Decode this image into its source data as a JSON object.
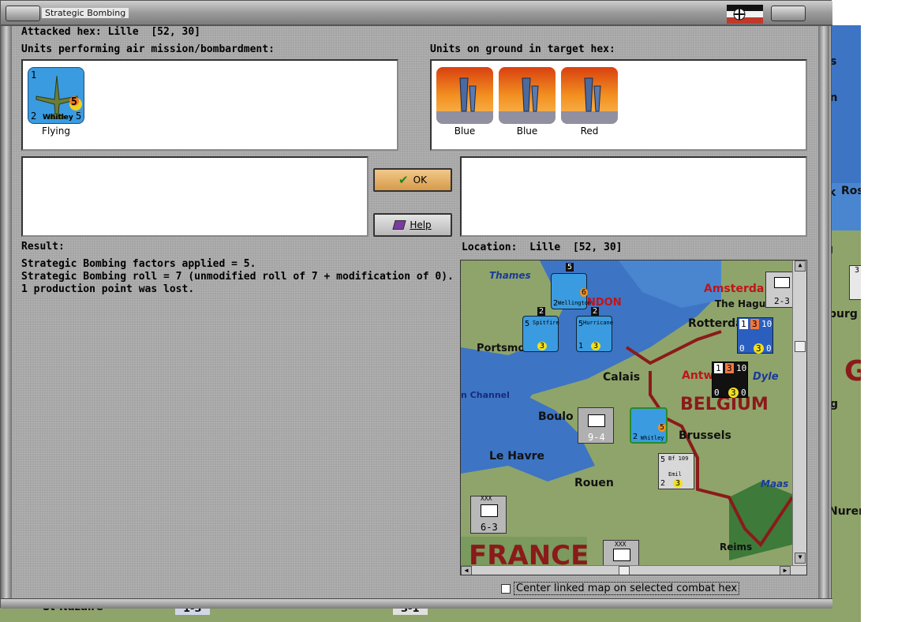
{
  "window": {
    "title": "Strategic Bombing"
  },
  "attacked_hex": "Attacked hex: Lille  [52, 30]",
  "air_units": {
    "heading": "Units performing air mission/bombardment:",
    "items": [
      {
        "name": "Whitley",
        "caption": "Flying",
        "top_left": "1",
        "bottom_left": "2",
        "bottom_right": "5",
        "badge": "5"
      }
    ]
  },
  "ground_units": {
    "heading": "Units on ground in target hex:",
    "items": [
      {
        "caption": "Blue"
      },
      {
        "caption": "Blue"
      },
      {
        "caption": "Red"
      }
    ]
  },
  "buttons": {
    "ok": "OK",
    "help": "Help"
  },
  "result": {
    "heading": "Result:",
    "lines": [
      "Strategic Bombing factors applied = 5.",
      "Strategic Bombing roll = 7 (unmodified roll of 7 + modification of 0).",
      "1 production point was lost."
    ]
  },
  "location": {
    "heading": "Location:  Lille  [52, 30]"
  },
  "minimap": {
    "labels": {
      "thames": "Thames",
      "london": "NDON",
      "amsterdam": "Amsterda",
      "the_hague": "The Hague",
      "rotterdam": "Rotterda",
      "portsmouth": "Portsmo",
      "calais": "Calais",
      "antwerp": "Antw",
      "dyle": "Dyle",
      "channel": "n Channel",
      "boulogne": "Boulo",
      "belgium": "BELGIUM",
      "brussels": "Brussels",
      "le_havre": "Le Havre",
      "rouen": "Rouen",
      "maas": "Maas",
      "reims": "Reims",
      "france": "FRANCE"
    },
    "counters": {
      "wellington": {
        "name": "Wellington",
        "top": "5",
        "a": "2",
        "b": "3",
        "badge": "6"
      },
      "spitfire": {
        "name": "Spitfire",
        "top": "2",
        "a": "5",
        "badge": "3"
      },
      "hurricane": {
        "name": "Hurricane",
        "top": "2",
        "a": "5",
        "b": "1",
        "badge": "3"
      },
      "inf_right": {
        "value": "2-3"
      },
      "dutch_1": {
        "a": "1",
        "b": "3",
        "c": "10",
        "d": "0",
        "e": "0",
        "badge": "3"
      },
      "dutch_2": {
        "a": "1",
        "b": "3",
        "c": "10",
        "d": "0",
        "e": "0",
        "badge": "3"
      },
      "inf_94": {
        "value": "9-4"
      },
      "whitley_map": {
        "name": "Whitley",
        "a": "2",
        "badge": "5"
      },
      "bf109": {
        "name": "Bf 109",
        "sub": "Emil",
        "a": "5",
        "b": "2",
        "badge": "3"
      },
      "inf_63": {
        "value": "6-3",
        "top": "XXX"
      },
      "inf_bottom": {
        "top": "XXX"
      }
    }
  },
  "background_map": {
    "right_labels": [
      "s",
      "en",
      "k",
      "Ros",
      "g",
      "burg",
      "G",
      "g",
      "Nuren",
      "3"
    ],
    "bottom_labels": [
      "St-Nazaire",
      "1-3",
      "3-1"
    ]
  },
  "checkbox": {
    "label": "Center linked map on selected combat hex",
    "checked": false
  },
  "colors": {
    "panel": "#a4a4a4",
    "ok_button": "#e0aa60",
    "sea": "#3d74c4",
    "land": "#8fa46a",
    "border_line": "#8b1a1a"
  }
}
